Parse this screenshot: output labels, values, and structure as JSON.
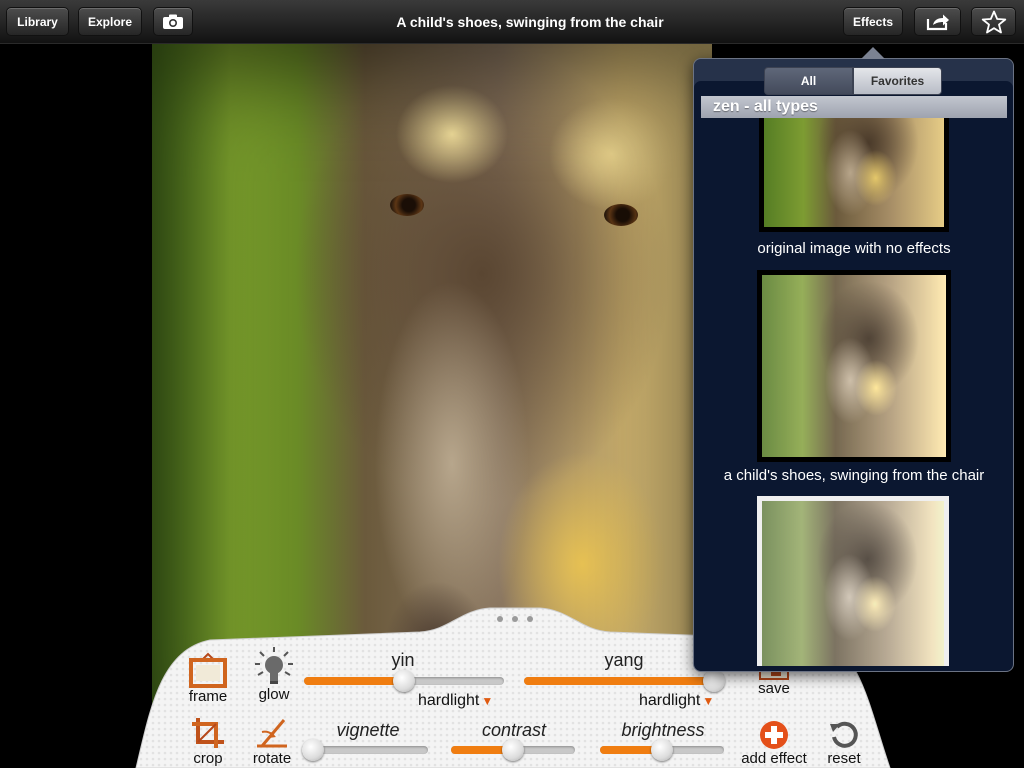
{
  "toolbar": {
    "library_label": "Library",
    "explore_label": "Explore",
    "title": "A child's shoes, swinging from the chair",
    "effects_label": "Effects"
  },
  "effects_popover": {
    "tabs": [
      {
        "label": "All",
        "selected": true
      },
      {
        "label": "Favorites",
        "selected": false
      }
    ],
    "group_header": "zen - all types",
    "items": [
      {
        "caption": "original image with no effects"
      },
      {
        "caption": "a child's shoes, swinging from the chair"
      },
      {
        "caption": ""
      }
    ]
  },
  "tools": {
    "frame": "frame",
    "glow": "glow",
    "crop": "crop",
    "rotate": "rotate",
    "save": "save",
    "add_effect": "add effect",
    "reset": "reset"
  },
  "sliders": {
    "yin": {
      "label": "yin",
      "value": 0.5,
      "blend_mode": "hardlight"
    },
    "yang": {
      "label": "yang",
      "value": 1.0,
      "blend_mode": "hardlight"
    },
    "vignette": {
      "label": "vignette",
      "value": 0.0
    },
    "contrast": {
      "label": "contrast",
      "value": 0.5
    },
    "brightness": {
      "label": "brightness",
      "value": 0.5
    }
  },
  "colors": {
    "accent_orange": "#f07d10",
    "popover_bg": "#0b1730",
    "toolbar_bg": "#1e1e1e"
  },
  "icons": [
    "camera-icon",
    "share-icon",
    "star-icon",
    "frame-icon",
    "glow-bulb-icon",
    "crop-icon",
    "rotate-icon",
    "save-icon",
    "add-effect-icon",
    "reset-icon"
  ]
}
